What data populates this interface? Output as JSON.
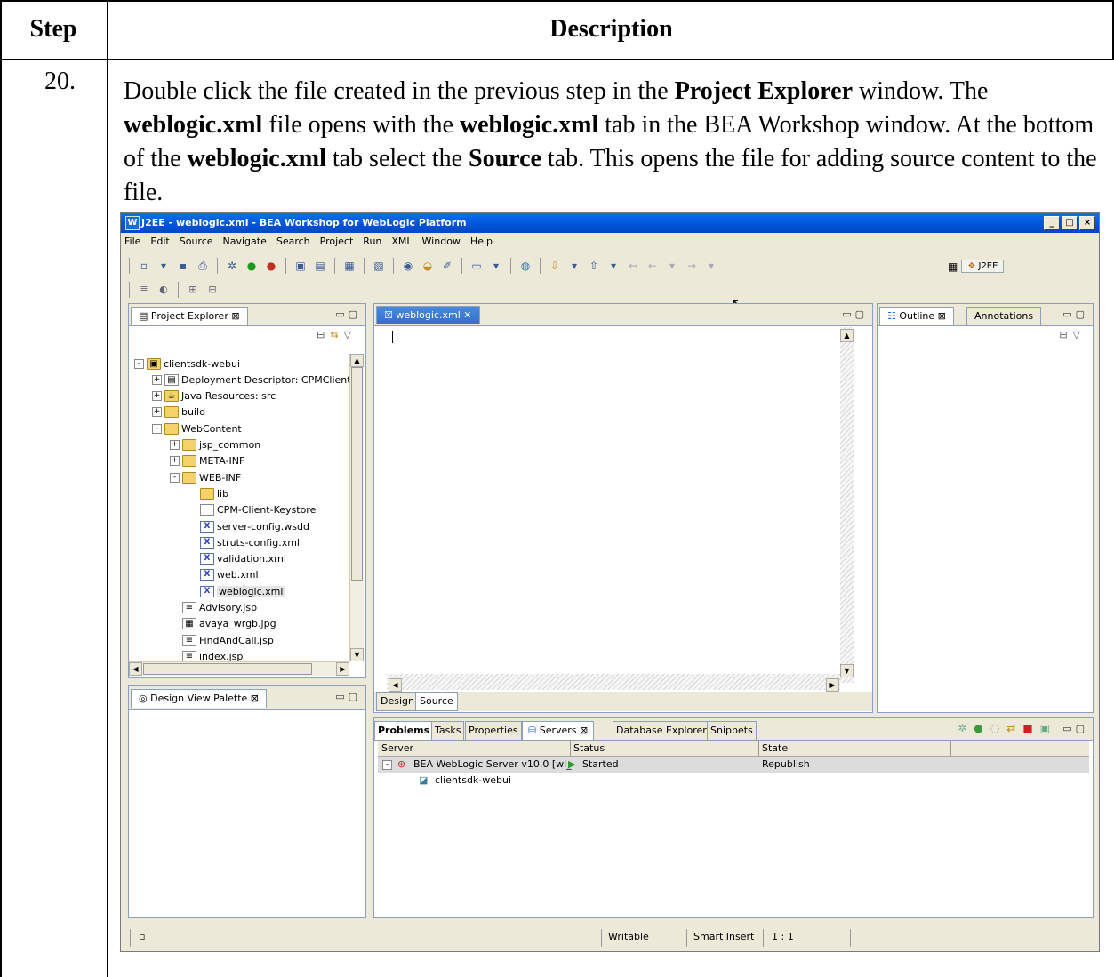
{
  "table": {
    "header_step": "Step",
    "header_description": "Description",
    "step_number": "20.",
    "description_parts": {
      "p1": "Double click the file created in the previous step in the ",
      "b1": "Project Explorer",
      "p2": " window. The ",
      "b2": "weblogic.xml",
      "p3": " file opens with the ",
      "b3": "weblogic.xml",
      "p4": " tab in the BEA Workshop window. At the bottom of the ",
      "b4": "weblogic.xml",
      "p5": " tab select the ",
      "b5": "Source",
      "p6": " tab. This opens the file for adding source content to the file."
    }
  },
  "window": {
    "title": "J2EE - weblogic.xml - BEA Workshop for WebLogic Platform",
    "menu": [
      "File",
      "Edit",
      "Source",
      "Navigate",
      "Search",
      "Project",
      "Run",
      "XML",
      "Window",
      "Help"
    ],
    "perspective": "J2EE"
  },
  "project_explorer": {
    "tab": "Project Explorer",
    "tree": [
      {
        "label": "clientsdk-webui",
        "depth": 0,
        "exp": "-",
        "icon": "project-icon"
      },
      {
        "label": "Deployment Descriptor: CPMClient",
        "depth": 1,
        "exp": "+",
        "icon": "descriptor-icon"
      },
      {
        "label": "Java Resources: src",
        "depth": 1,
        "exp": "+",
        "icon": "java-resources-icon"
      },
      {
        "label": "build",
        "depth": 1,
        "exp": "+",
        "icon": "folder-icon"
      },
      {
        "label": "WebContent",
        "depth": 1,
        "exp": "-",
        "icon": "folder-icon"
      },
      {
        "label": "jsp_common",
        "depth": 2,
        "exp": "+",
        "icon": "folder-icon"
      },
      {
        "label": "META-INF",
        "depth": 2,
        "exp": "+",
        "icon": "folder-icon"
      },
      {
        "label": "WEB-INF",
        "depth": 2,
        "exp": "-",
        "icon": "folder-icon"
      },
      {
        "label": "lib",
        "depth": 3,
        "exp": "",
        "icon": "folder-icon"
      },
      {
        "label": "CPM-Client-Keystore",
        "depth": 3,
        "exp": "",
        "icon": "file-icon"
      },
      {
        "label": "server-config.wsdd",
        "depth": 3,
        "exp": "",
        "icon": "xml-file-icon"
      },
      {
        "label": "struts-config.xml",
        "depth": 3,
        "exp": "",
        "icon": "xml-file-icon"
      },
      {
        "label": "validation.xml",
        "depth": 3,
        "exp": "",
        "icon": "xml-file-icon"
      },
      {
        "label": "web.xml",
        "depth": 3,
        "exp": "",
        "icon": "xml-file-icon"
      },
      {
        "label": "weblogic.xml",
        "depth": 3,
        "exp": "",
        "icon": "xml-file-icon",
        "selected": true
      },
      {
        "label": "Advisory.jsp",
        "depth": 2,
        "exp": "",
        "icon": "jsp-file-icon"
      },
      {
        "label": "avaya_wrgb.jpg",
        "depth": 2,
        "exp": "",
        "icon": "image-file-icon"
      },
      {
        "label": "FindAndCall.jsp",
        "depth": 2,
        "exp": "",
        "icon": "jsp-file-icon"
      },
      {
        "label": "index.jsp",
        "depth": 2,
        "exp": "",
        "icon": "jsp-file-icon"
      }
    ]
  },
  "palette": {
    "tab": "Design View Palette"
  },
  "editor": {
    "tab": "weblogic.xml",
    "bottom_tabs": [
      "Design",
      "Source"
    ]
  },
  "outline": {
    "tab": "Outline",
    "tab2": "Annotations"
  },
  "bottom_panel": {
    "tabs": [
      "Problems",
      "Tasks",
      "Properties",
      "Servers",
      "Database Explorer",
      "Snippets"
    ],
    "columns": [
      "Server",
      "Status",
      "State"
    ],
    "rows": [
      {
        "server": "BEA WebLogic Server v10.0 [wl_",
        "status": "Started",
        "state": "Republish"
      },
      {
        "server": "clientsdk-webui",
        "status": "",
        "state": ""
      }
    ]
  },
  "status_bar": {
    "mode": "Writable",
    "insert": "Smart Insert",
    "position": "1 : 1"
  }
}
